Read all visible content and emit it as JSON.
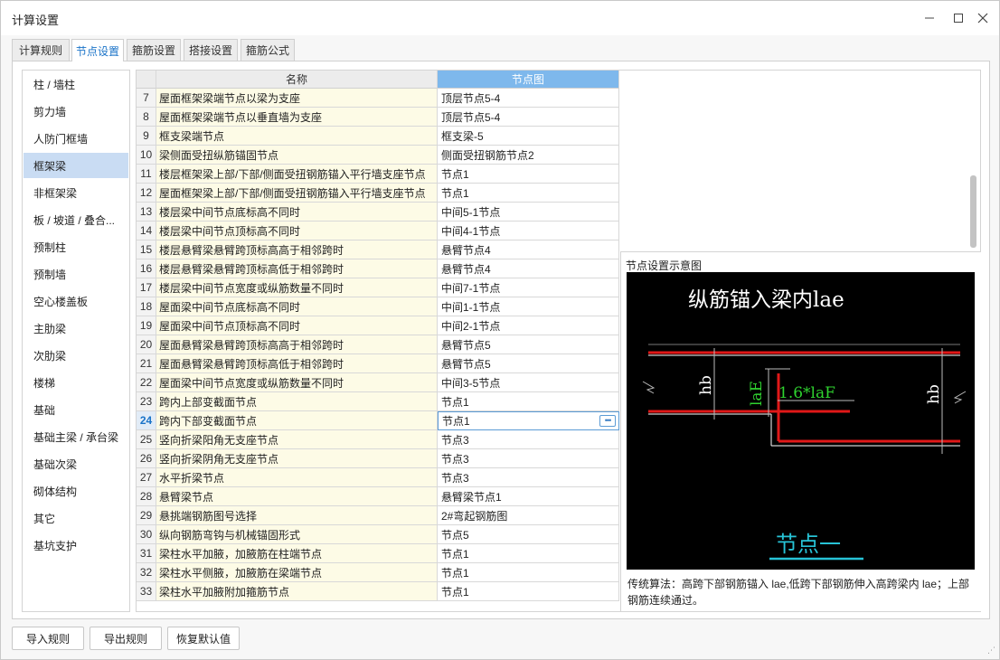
{
  "window": {
    "title": "计算设置"
  },
  "tabs": [
    "计算规则",
    "节点设置",
    "箍筋设置",
    "搭接设置",
    "箍筋公式"
  ],
  "categories": [
    "柱 / 墙柱",
    "剪力墙",
    "人防门框墙",
    "框架梁",
    "非框架梁",
    "板 / 坡道 / 叠合...",
    "预制柱",
    "预制墙",
    "空心楼盖板",
    "主肋梁",
    "次肋梁",
    "楼梯",
    "基础",
    "基础主梁 / 承台梁",
    "基础次梁",
    "砌体结构",
    "其它",
    "基坑支护"
  ],
  "grid": {
    "col_name": "名称",
    "col_node": "节点图",
    "rows": [
      {
        "num": "7",
        "name": "屋面框架梁端节点以梁为支座",
        "node": "顶层节点5-4"
      },
      {
        "num": "8",
        "name": "屋面框架梁端节点以垂直墙为支座",
        "node": "顶层节点5-4"
      },
      {
        "num": "9",
        "name": "框支梁端节点",
        "node": "框支梁-5"
      },
      {
        "num": "10",
        "name": "梁侧面受扭纵筋锚固节点",
        "node": "侧面受扭钢筋节点2"
      },
      {
        "num": "11",
        "name": "楼层框架梁上部/下部/侧面受扭钢筋锚入平行墙支座节点",
        "node": "节点1"
      },
      {
        "num": "12",
        "name": "屋面框架梁上部/下部/侧面受扭钢筋锚入平行墙支座节点",
        "node": "节点1"
      },
      {
        "num": "13",
        "name": "楼层梁中间节点底标高不同时",
        "node": "中间5-1节点"
      },
      {
        "num": "14",
        "name": "楼层梁中间节点顶标高不同时",
        "node": "中间4-1节点"
      },
      {
        "num": "15",
        "name": "楼层悬臂梁悬臂跨顶标高高于相邻跨时",
        "node": "悬臂节点4"
      },
      {
        "num": "16",
        "name": "楼层悬臂梁悬臂跨顶标高低于相邻跨时",
        "node": "悬臂节点4"
      },
      {
        "num": "17",
        "name": "楼层梁中间节点宽度或纵筋数量不同时",
        "node": "中间7-1节点"
      },
      {
        "num": "18",
        "name": "屋面梁中间节点底标高不同时",
        "node": "中间1-1节点"
      },
      {
        "num": "19",
        "name": "屋面梁中间节点顶标高不同时",
        "node": "中间2-1节点"
      },
      {
        "num": "20",
        "name": "屋面悬臂梁悬臂跨顶标高高于相邻跨时",
        "node": "悬臂节点5"
      },
      {
        "num": "21",
        "name": "屋面悬臂梁悬臂跨顶标高低于相邻跨时",
        "node": "悬臂节点5"
      },
      {
        "num": "22",
        "name": "屋面梁中间节点宽度或纵筋数量不同时",
        "node": "中间3-5节点"
      },
      {
        "num": "23",
        "name": "跨内上部变截面节点",
        "node": "节点1"
      },
      {
        "num": "24",
        "name": "跨内下部变截面节点",
        "node": "节点1"
      },
      {
        "num": "25",
        "name": "竖向折梁阳角无支座节点",
        "node": "节点3"
      },
      {
        "num": "26",
        "name": "竖向折梁阴角无支座节点",
        "node": "节点3"
      },
      {
        "num": "27",
        "name": "水平折梁节点",
        "node": "节点3"
      },
      {
        "num": "28",
        "name": "悬臂梁节点",
        "node": "悬臂梁节点1"
      },
      {
        "num": "29",
        "name": "悬挑端钢筋图号选择",
        "node": "2#弯起钢筋图"
      },
      {
        "num": "30",
        "name": "纵向钢筋弯钩与机械锚固形式",
        "node": "节点5"
      },
      {
        "num": "31",
        "name": "梁柱水平加腋，加腋筋在柱端节点",
        "node": "节点1"
      },
      {
        "num": "32",
        "name": "梁柱水平侧腋，加腋筋在梁端节点",
        "node": "节点1"
      },
      {
        "num": "33",
        "name": "梁柱水平加腋附加箍筋节点",
        "node": "节点1"
      }
    ],
    "ellipsis": "•••"
  },
  "preview": {
    "title": "节点设置示意图",
    "diagram_heading": "纵筋锚入梁内lae",
    "label_hb_left": "hb",
    "label_hb_right": "hb",
    "label_lae": "laE",
    "label_formula": "1.6*laF",
    "caption": "节点一",
    "description": "传统算法：高跨下部钢筋锚入 lae,低跨下部钢筋伸入高跨梁内 lae；上部钢筋连续通过。"
  },
  "buttons": {
    "import": "导入规则",
    "export": "导出规则",
    "restore": "恢复默认值"
  },
  "icons": {
    "minimize": "minimize-icon",
    "maximize": "maximize-icon",
    "close": "close-icon",
    "more": "ellipsis-icon"
  }
}
